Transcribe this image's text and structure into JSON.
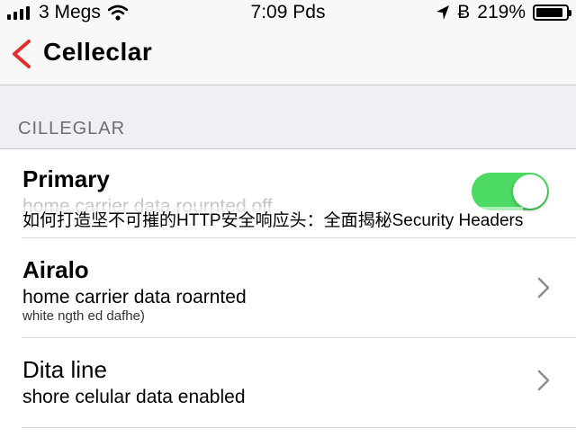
{
  "status_bar": {
    "carrier": "3 Megs",
    "time": "7:09 Pds",
    "bluetooth_glyph": "Ƀ",
    "battery_text": "219%",
    "battery_level": 0.9
  },
  "nav": {
    "title": "Celleclar"
  },
  "section": {
    "header": "CILLEGLAR"
  },
  "rows": [
    {
      "title": "Primary",
      "subtitle": "home carrier data rournted off",
      "toggle_on": true
    },
    {
      "title": "Airalo",
      "subtitle": "home carrier data roarnted",
      "small": "white ngth ed dafhe)"
    },
    {
      "title": "Dita line",
      "subtitle": "shore celular data enabled"
    }
  ],
  "overlay": {
    "text": "如何打造坚不可摧的HTTP安全响应头：全面揭秘Security Headers"
  },
  "colors": {
    "accent": "#e0302f",
    "toggle_on": "#4cd964",
    "section_text": "#6d6d72"
  }
}
